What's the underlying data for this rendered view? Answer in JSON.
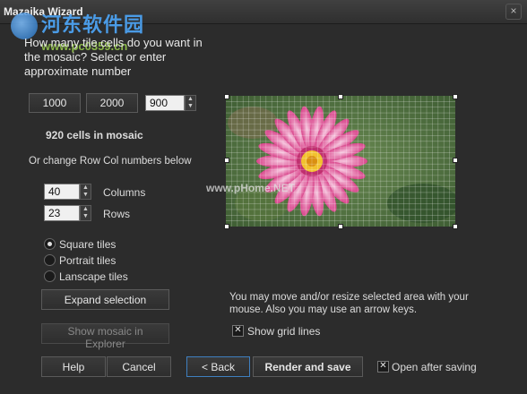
{
  "window": {
    "title": "Mazaika Wizard",
    "close_glyph": "×"
  },
  "watermark": {
    "top": "河东软件园",
    "url": "www.pc0359.cn",
    "center": "www.pHome.NET"
  },
  "question": "How many tile cells do you want in the mosaic? Select or enter approximate number",
  "presets": {
    "btn1": "1000",
    "btn2": "2000",
    "value": "900"
  },
  "cells_text": "920 cells in mosaic",
  "change_text": "Or change Row Col numbers below",
  "columns": {
    "value": "40",
    "label": "Columns"
  },
  "rows": {
    "value": "23",
    "label": "Rows"
  },
  "tile_shape": {
    "options": [
      "Square tiles",
      "Portrait tiles",
      "Lanscape tiles"
    ],
    "selected": "Square tiles"
  },
  "buttons": {
    "expand": "Expand selection",
    "show_mosaic": "Show mosaic in Explorer",
    "help": "Help",
    "cancel": "Cancel",
    "back": "< Back",
    "render": "Render and save"
  },
  "hint": "You may move and/or resize selected area with your mouse. Also you may use an arrow keys.",
  "show_grid": {
    "label": "Show grid lines",
    "checked": true
  },
  "open_after": {
    "label": "Open after saving",
    "checked": true
  },
  "grid": {
    "columns": 40,
    "rows": 23
  }
}
